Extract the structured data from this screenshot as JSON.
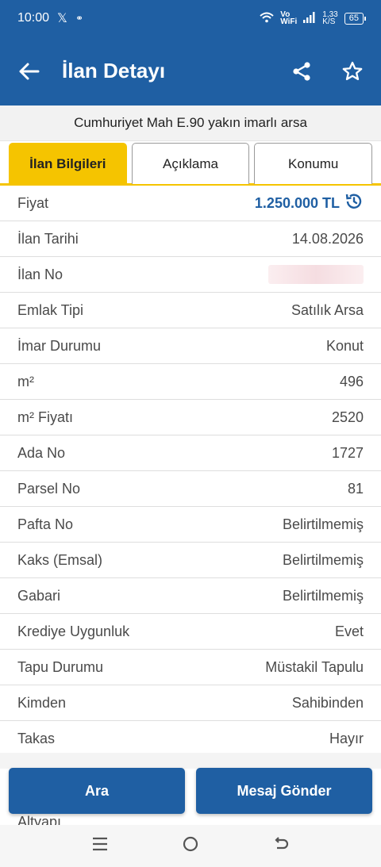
{
  "status_bar": {
    "time": "10:00",
    "net_speed": "1,33\nK/S",
    "battery": "65",
    "vowifi": "Vo\nWiFi"
  },
  "toolbar": {
    "title": "İlan Detayı"
  },
  "listing": {
    "subtitle": "Cumhuriyet Mah E.90 yakın imarlı arsa"
  },
  "tabs": [
    {
      "label": "İlan Bilgileri",
      "active": true
    },
    {
      "label": "Açıklama",
      "active": false
    },
    {
      "label": "Konumu",
      "active": false
    }
  ],
  "details": [
    {
      "label": "Fiyat",
      "value": "1.250.000 TL"
    },
    {
      "label": "İlan Tarihi",
      "value": "14.08.2026"
    },
    {
      "label": "İlan No",
      "value": ""
    },
    {
      "label": "Emlak Tipi",
      "value": "Satılık Arsa"
    },
    {
      "label": "İmar Durumu",
      "value": "Konut"
    },
    {
      "label": "m²",
      "value": "496"
    },
    {
      "label": "m² Fiyatı",
      "value": "2520"
    },
    {
      "label": "Ada No",
      "value": "1727"
    },
    {
      "label": "Parsel No",
      "value": "81"
    },
    {
      "label": "Pafta No",
      "value": "Belirtilmemiş"
    },
    {
      "label": "Kaks (Emsal)",
      "value": "Belirtilmemiş"
    },
    {
      "label": "Gabari",
      "value": "Belirtilmemiş"
    },
    {
      "label": "Krediye Uygunluk",
      "value": "Evet"
    },
    {
      "label": "Tapu Durumu",
      "value": "Müstakil Tapulu"
    },
    {
      "label": "Kimden",
      "value": "Sahibinden"
    },
    {
      "label": "Takas",
      "value": "Hayır"
    }
  ],
  "peek_label": "Altyapı",
  "actions": {
    "call_label": "Ara",
    "message_label": "Mesaj Gönder"
  },
  "colors": {
    "primary": "#1f5fa3",
    "accent": "#f5c400"
  }
}
